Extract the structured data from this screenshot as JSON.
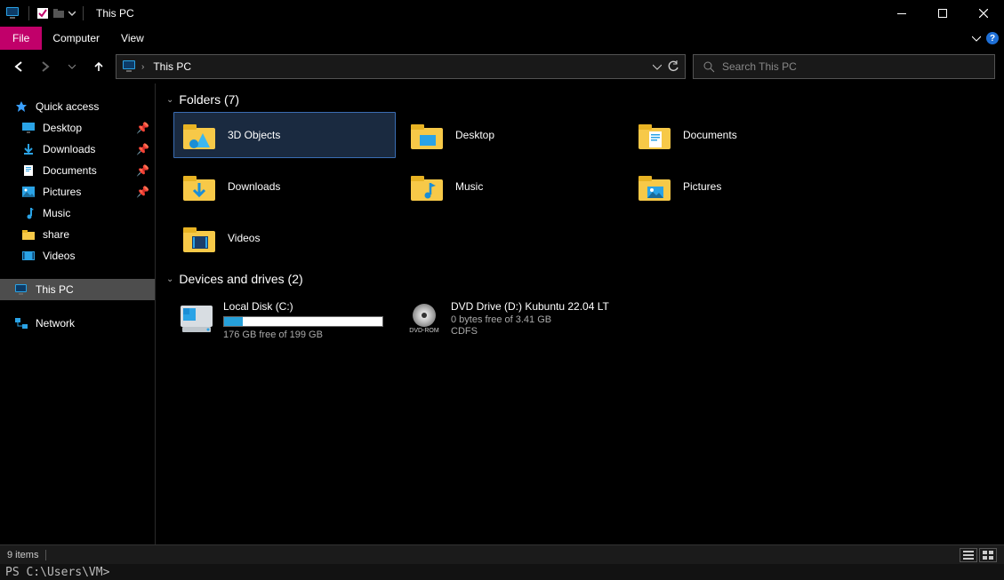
{
  "window": {
    "title": "This PC"
  },
  "ribbon": {
    "file": "File",
    "computer": "Computer",
    "view": "View"
  },
  "nav": {
    "breadcrumb": "This PC"
  },
  "search": {
    "placeholder": "Search This PC"
  },
  "sidebar": {
    "quick_access": "Quick access",
    "items": [
      {
        "label": "Desktop",
        "pinned": true
      },
      {
        "label": "Downloads",
        "pinned": true
      },
      {
        "label": "Documents",
        "pinned": true
      },
      {
        "label": "Pictures",
        "pinned": true
      },
      {
        "label": "Music",
        "pinned": false
      },
      {
        "label": "share",
        "pinned": false
      },
      {
        "label": "Videos",
        "pinned": false
      }
    ],
    "this_pc": "This PC",
    "network": "Network"
  },
  "groups": {
    "folders_header": "Folders (7)",
    "drives_header": "Devices and drives (2)"
  },
  "folders": [
    {
      "label": "3D Objects"
    },
    {
      "label": "Desktop"
    },
    {
      "label": "Documents"
    },
    {
      "label": "Downloads"
    },
    {
      "label": "Music"
    },
    {
      "label": "Pictures"
    },
    {
      "label": "Videos"
    }
  ],
  "drives": [
    {
      "name": "Local Disk (C:)",
      "free": "176 GB free of 199 GB",
      "used_pct": 12
    },
    {
      "name": "DVD Drive (D:) Kubuntu 22.04 LT",
      "free": "0 bytes free of 3.41 GB",
      "fs": "CDFS",
      "rom_label": "DVD-ROM"
    }
  ],
  "status": {
    "text": "9 items"
  },
  "terminal": {
    "prompt": "PS C:\\Users\\VM>"
  }
}
